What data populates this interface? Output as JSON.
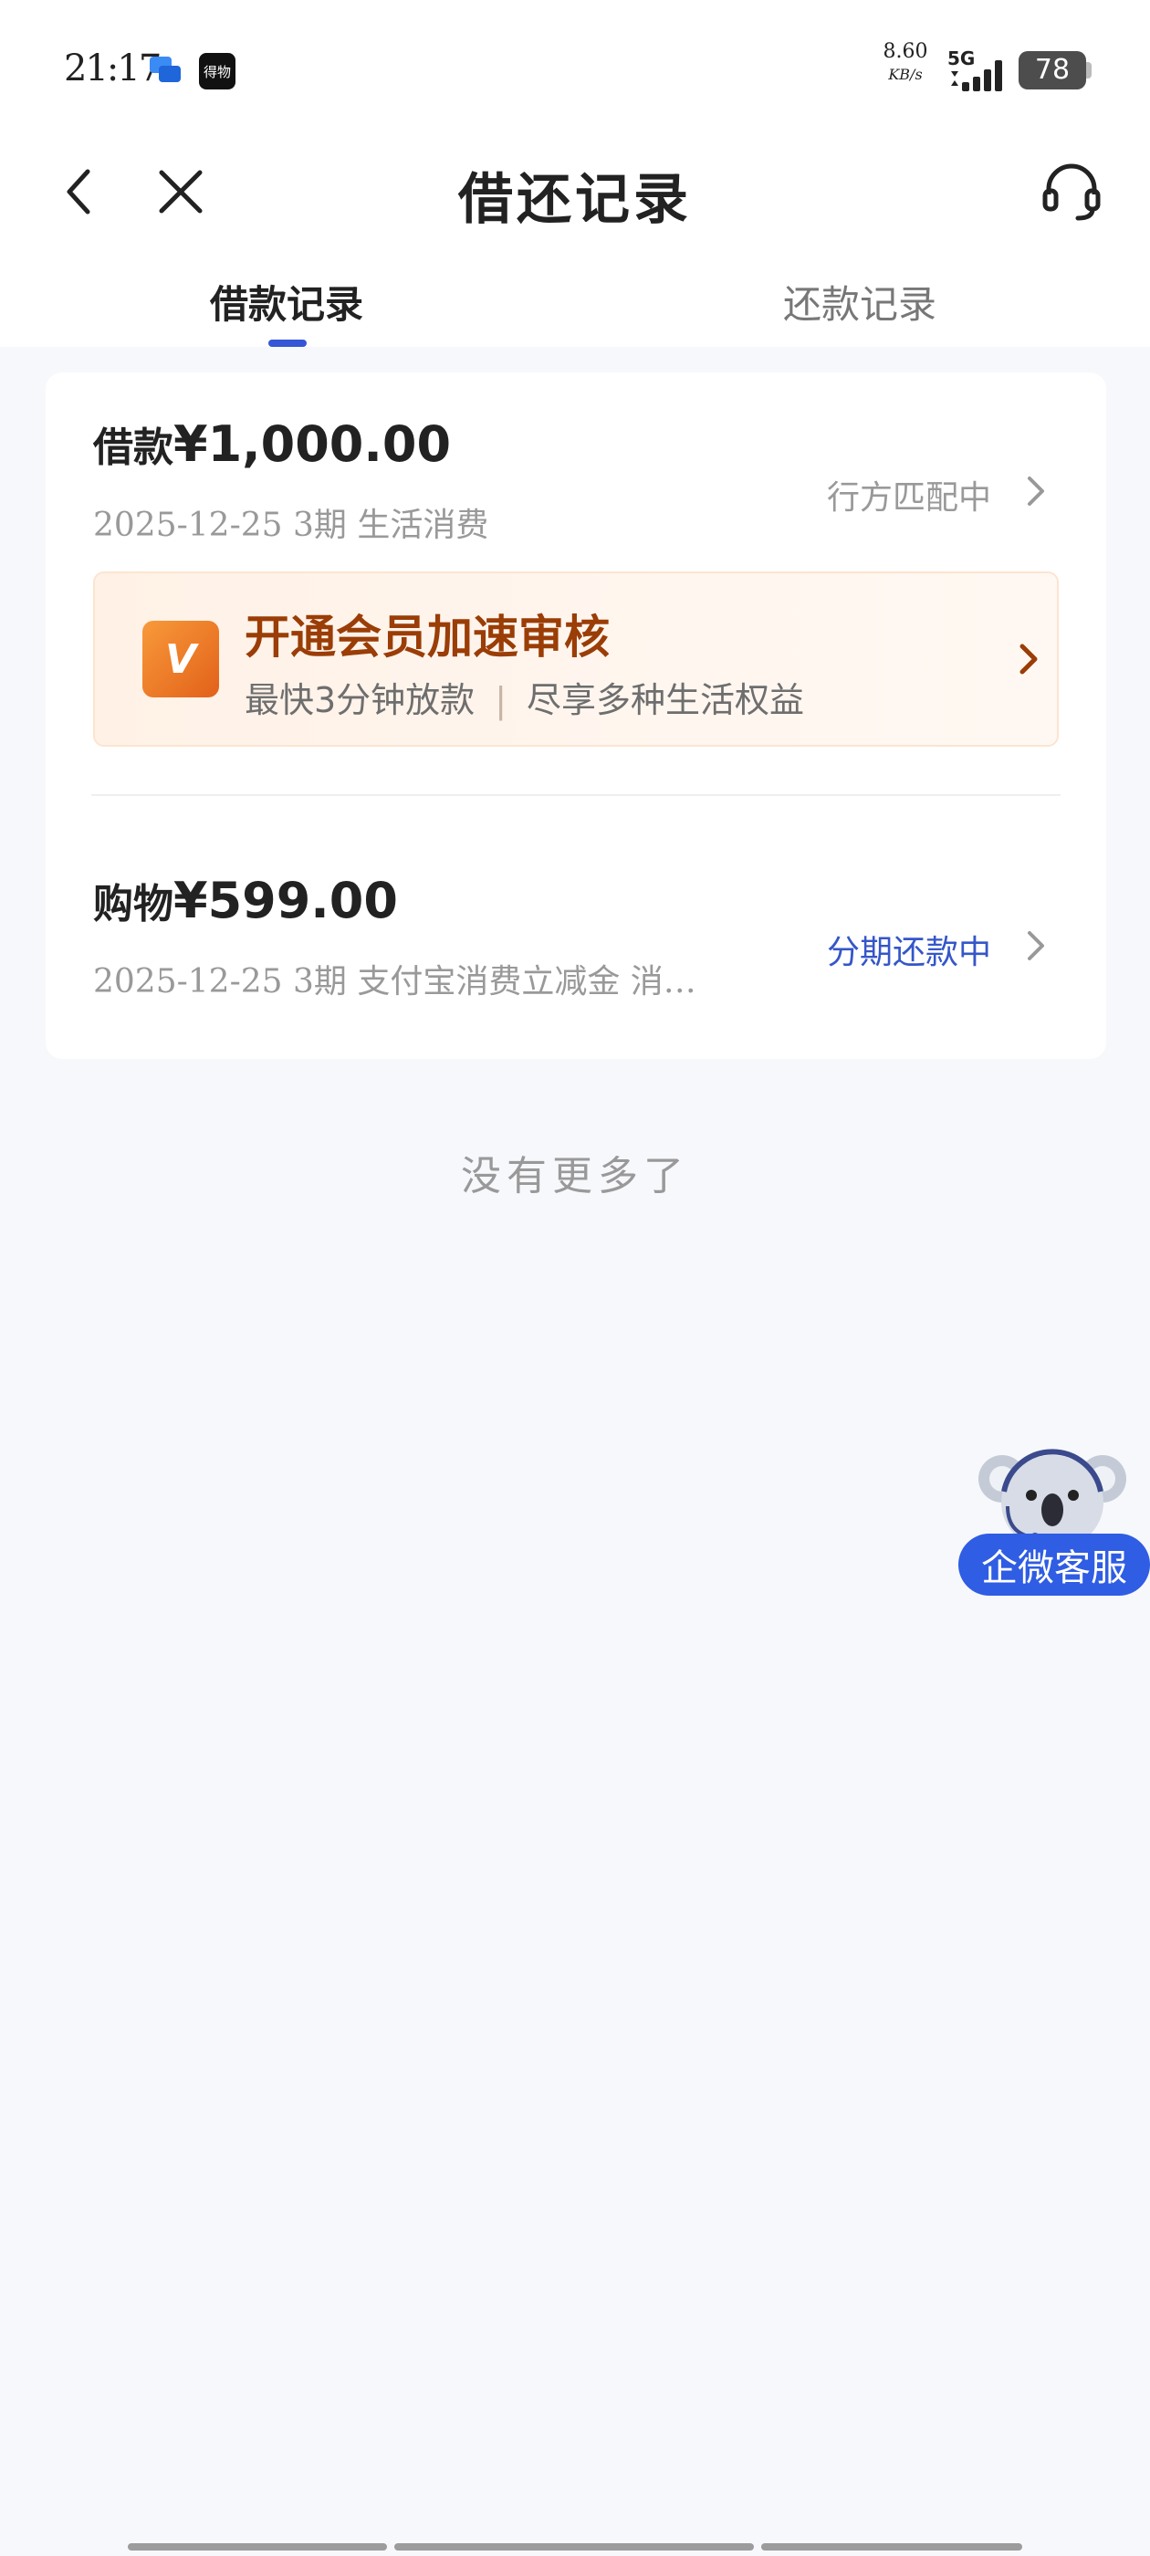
{
  "status_bar": {
    "time": "21:17",
    "app_icon_text": "得物",
    "speed_value": "8.60",
    "speed_unit": "KB/s",
    "network": "5G",
    "battery": "78"
  },
  "nav": {
    "title": "借还记录"
  },
  "tabs": [
    {
      "label": "借款记录",
      "active": true
    },
    {
      "label": "还款记录",
      "active": false
    }
  ],
  "records": [
    {
      "kind": "借款",
      "amount": "¥1,000.00",
      "meta": "2025-12-25 3期  生活消费",
      "status": "行方匹配中",
      "status_color": "#999999"
    },
    {
      "kind": "购物",
      "amount": "¥599.00",
      "meta": "2025-12-25 3期  支付宝消费立减金 消…",
      "status": "分期还款中",
      "status_color": "#3556c8"
    }
  ],
  "vip_banner": {
    "badge": "V",
    "title": "开通会员加速审核",
    "sub_left": "最快3分钟放款",
    "separator": "|",
    "sub_right": "尽享多种生活权益"
  },
  "footer_text": "没有更多了",
  "service_button": "企微客服",
  "colors": {
    "accent": "#3556d6",
    "service_blue": "#2f5de3",
    "vip_title": "#9a3d06"
  },
  "icons": [
    "back-arrow-icon",
    "close-icon",
    "headset-icon",
    "chevron-right-icon",
    "koala-mascot-icon",
    "chat-icon",
    "signal-icon"
  ]
}
